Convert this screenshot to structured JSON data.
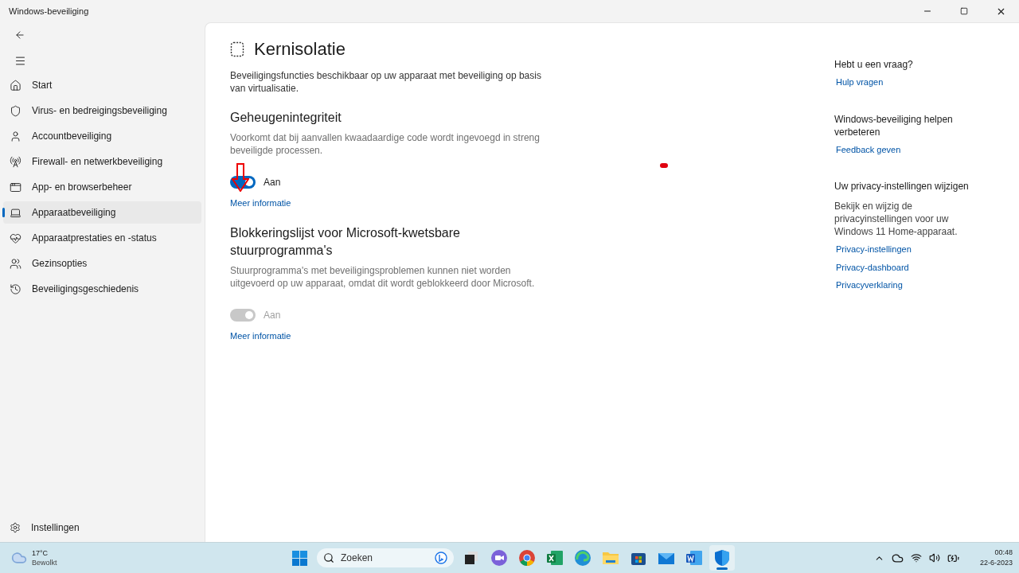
{
  "window": {
    "title": "Windows-beveiliging"
  },
  "sidebar": {
    "items": [
      {
        "kind": "home",
        "label": "Start",
        "selected": false
      },
      {
        "kind": "shield",
        "label": "Virus- en bedreigingsbeveiliging",
        "selected": false
      },
      {
        "kind": "account",
        "label": "Accountbeveiliging",
        "selected": false
      },
      {
        "kind": "network",
        "label": "Firewall- en netwerkbeveiliging",
        "selected": false
      },
      {
        "kind": "app",
        "label": "App- en browserbeheer",
        "selected": false
      },
      {
        "kind": "device",
        "label": "Apparaatbeveiliging",
        "selected": true
      },
      {
        "kind": "health",
        "label": "Apparaatprestaties en -status",
        "selected": false
      },
      {
        "kind": "family",
        "label": "Gezinsopties",
        "selected": false
      },
      {
        "kind": "history",
        "label": "Beveiligingsgeschiedenis",
        "selected": false
      }
    ],
    "settings": "Instellingen"
  },
  "page": {
    "title": "Kernisolatie",
    "description": "Beveiligingsfuncties beschikbaar op uw apparaat met beveiliging op basis van virtualisatie.",
    "sections": [
      {
        "title": "Geheugenintegriteit",
        "description": "Voorkomt dat bij aanvallen kwaadaardige code wordt ingevoegd in streng beveiligde processen.",
        "toggle": {
          "on": true,
          "disabled": false,
          "label": "Aan"
        },
        "link": "Meer informatie"
      },
      {
        "title": "Blokkeringslijst voor Microsoft-kwetsbare stuurprogramma's",
        "description": "Stuurprogramma's met beveiligingsproblemen kunnen niet worden uitgevoerd op uw apparaat, omdat dit wordt geblokkeerd door Microsoft.",
        "toggle": {
          "on": true,
          "disabled": true,
          "label": "Aan"
        },
        "link": "Meer informatie"
      }
    ]
  },
  "side_panel": [
    {
      "heading": "Hebt u een vraag?",
      "links": [
        "Hulp vragen"
      ]
    },
    {
      "heading": "Windows-beveiliging helpen verbeteren",
      "links": [
        "Feedback geven"
      ]
    },
    {
      "heading": "Uw privacy-instellingen wijzigen",
      "text": "Bekijk en wijzig de privacyinstellingen voor uw Windows 11 Home-apparaat.",
      "links": [
        "Privacy-instellingen",
        "Privacy-dashboard",
        "Privacyverklaring"
      ]
    }
  ],
  "taskbar": {
    "weather": {
      "temp": "17°C",
      "condition": "Bewolkt"
    },
    "search_placeholder": "Zoeken",
    "apps": [
      {
        "kind": "taskview",
        "active": false
      },
      {
        "kind": "chat",
        "active": false
      },
      {
        "kind": "chrome",
        "active": false
      },
      {
        "kind": "excel",
        "active": false
      },
      {
        "kind": "edge",
        "active": false
      },
      {
        "kind": "files",
        "active": false
      },
      {
        "kind": "store",
        "active": false
      },
      {
        "kind": "mail",
        "active": false
      },
      {
        "kind": "word",
        "active": false
      },
      {
        "kind": "defender",
        "active": true
      }
    ],
    "time": "00:48",
    "date": "22-6-2023"
  }
}
